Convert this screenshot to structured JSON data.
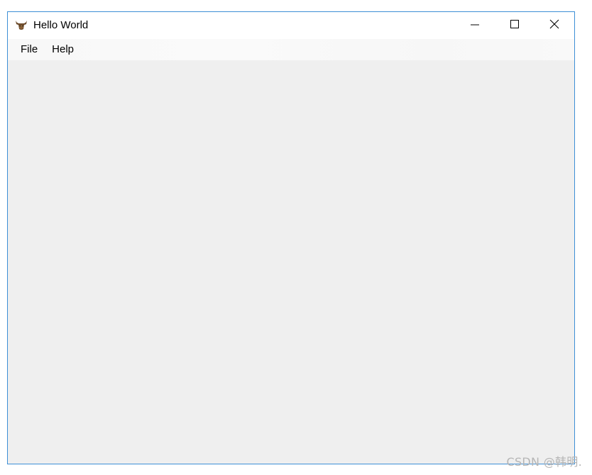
{
  "window": {
    "title": "Hello World",
    "icon": "bull-head-icon",
    "accent_border": "#3d8fd6",
    "controls": {
      "minimize_icon": "minimize-icon",
      "maximize_icon": "maximize-icon",
      "close_icon": "close-icon"
    }
  },
  "menubar": {
    "items": [
      {
        "label": "File"
      },
      {
        "label": "Help"
      }
    ]
  },
  "watermark": {
    "text": "CSDN @韩明."
  }
}
